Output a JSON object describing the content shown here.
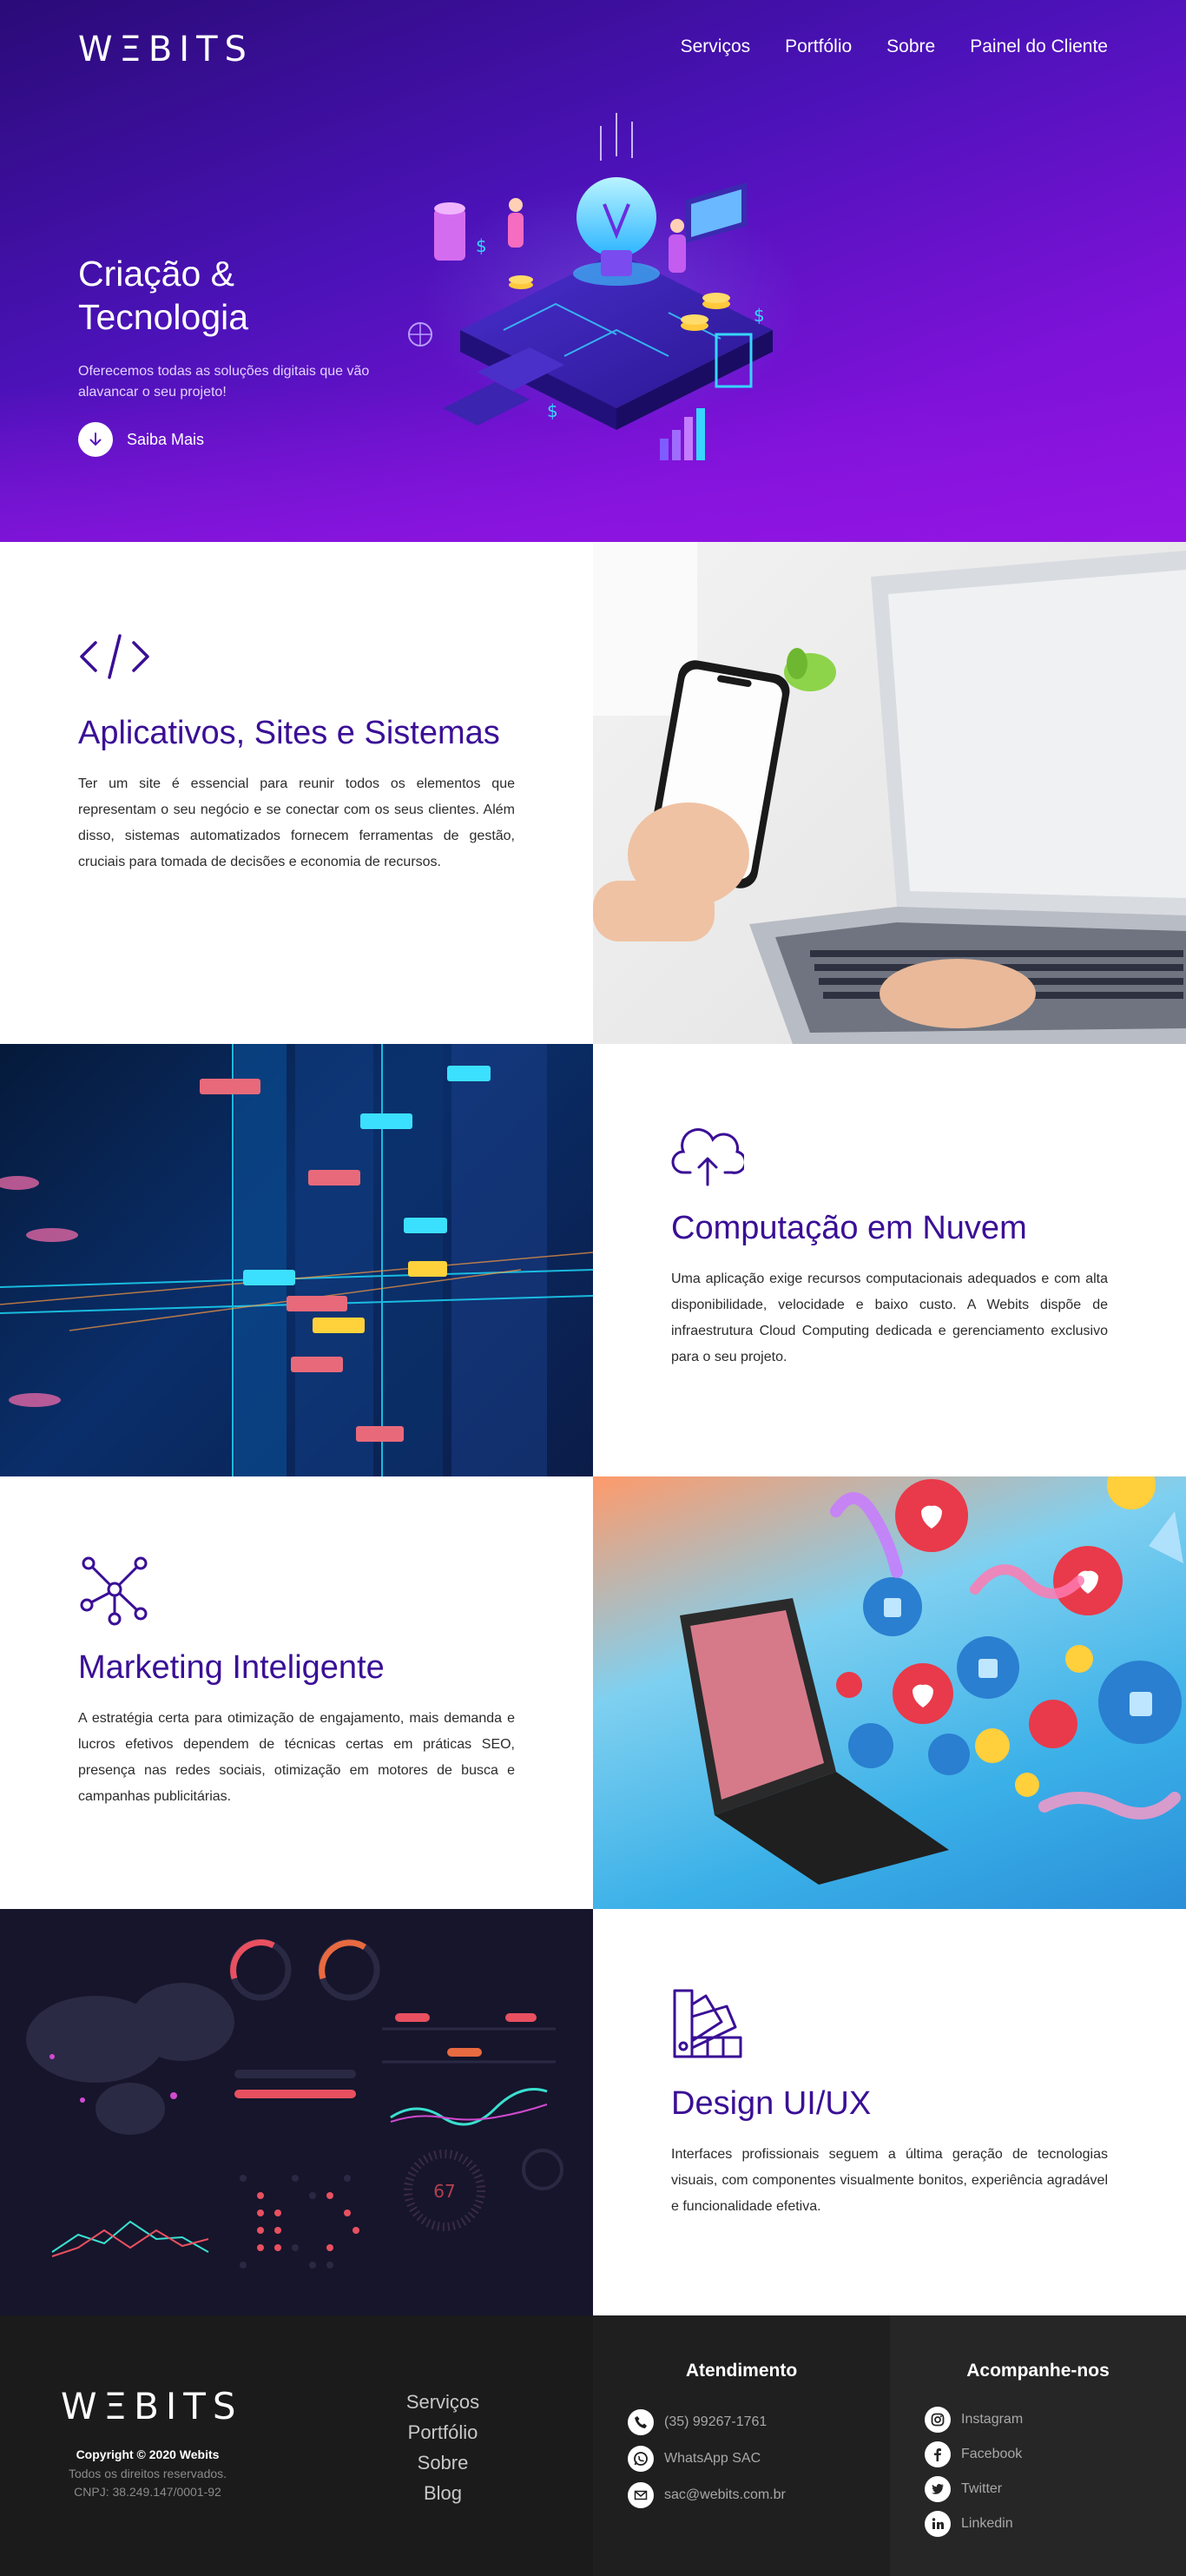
{
  "brand": {
    "logo": "WΞBITS"
  },
  "nav": {
    "items": [
      {
        "label": "Serviços"
      },
      {
        "label": "Portfólio"
      },
      {
        "label": "Sobre"
      },
      {
        "label": "Painel do Cliente"
      }
    ]
  },
  "hero": {
    "title": "Criação & Tecnologia",
    "subtitle": "Oferecemos todas as soluções digitais que vão alavancar o seu projeto!",
    "cta": "Saiba Mais"
  },
  "services": [
    {
      "icon": "code-icon",
      "title": "Aplicativos, Sites e Sistemas",
      "text": "Ter um site é essencial para reunir todos os elementos que representam o seu negócio e se conectar com os seus clientes. Além disso, sistemas automatizados fornecem ferramentas de gestão, cruciais para tomada de decisões e economia de recursos."
    },
    {
      "icon": "cloud-upload-icon",
      "title": "Computação em Nuvem",
      "text": "Uma aplicação exige recursos computacionais adequados e com alta disponibilidade, velocidade e baixo custo. A Webits dispõe de infraestrutura Cloud Computing dedicada e gerenciamento exclusivo para o seu projeto."
    },
    {
      "icon": "network-icon",
      "title": "Marketing Inteligente",
      "text": "A estratégia certa para otimização de engajamento, mais demanda e lucros efetivos dependem de técnicas certas em práticas SEO, presença nas redes sociais, otimização em motores de busca e campanhas publicitárias."
    },
    {
      "icon": "color-palette-icon",
      "title": "Design UI/UX",
      "text": "Interfaces profissionais seguem a última geração de tecnologias visuais, com componentes visualmente bonitos, experiência agradável e funcionalidade efetiva."
    }
  ],
  "dashboard_mock": {
    "gauge_value": "67"
  },
  "footer": {
    "logo": "WΞBITS",
    "copyright": "Copyright © 2020 Webits",
    "rights": "Todos os direitos reservados.",
    "cnpj": "CNPJ: 38.249.147/0001-92",
    "links": [
      "Serviços",
      "Portfólio",
      "Sobre",
      "Blog"
    ],
    "support": {
      "title": "Atendimento",
      "phone": "(35) 99267-1761",
      "whatsapp": "WhatsApp SAC",
      "email": "sac@webits.com.br"
    },
    "social": {
      "title": "Acompanhe-nos",
      "items": [
        "Instagram",
        "Facebook",
        "Twitter",
        "Linkedin"
      ]
    }
  },
  "colors": {
    "accent": "#3a0f96",
    "hero_start": "#2a0b78",
    "hero_end": "#8f14e0"
  }
}
